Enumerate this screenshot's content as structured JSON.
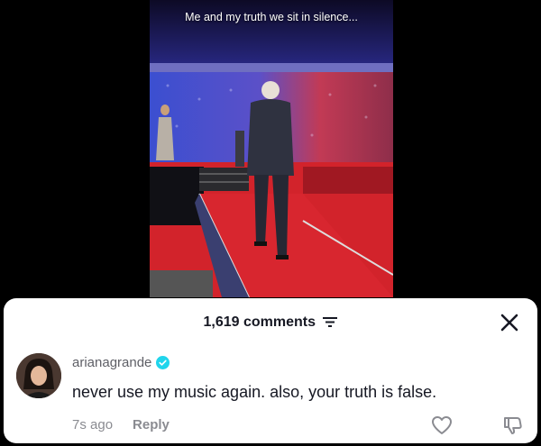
{
  "video": {
    "caption": "Me and my truth we sit in silence..."
  },
  "comments": {
    "count_label": "1,619 comments",
    "sort_icon": "sort-lines-icon",
    "close_icon": "close-icon"
  },
  "comment": {
    "username": "arianagrande",
    "verified": true,
    "text": "never use my music again. also, your truth is false.",
    "timestamp": "7s ago",
    "reply_label": "Reply",
    "like_icon": "heart-outline-icon",
    "dislike_icon": "thumbs-down-icon"
  },
  "colors": {
    "verified": "#20d5ec",
    "text_primary": "#161823",
    "text_secondary": "#8a8b91"
  }
}
